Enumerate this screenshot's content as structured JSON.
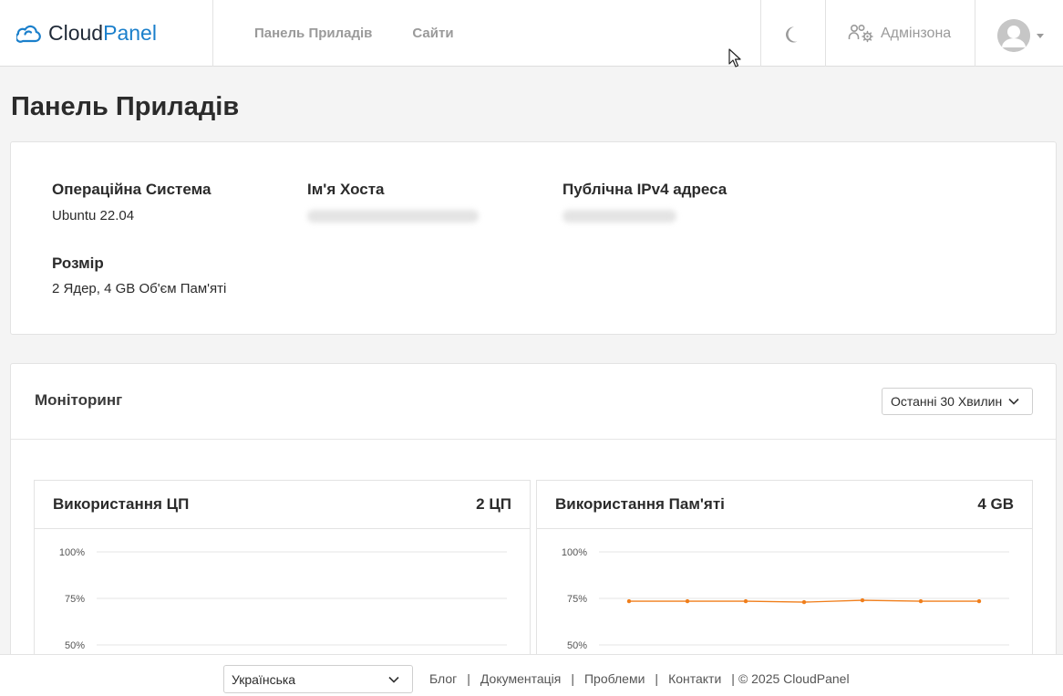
{
  "header": {
    "logo": {
      "part1": "Cloud",
      "part2": "Panel"
    },
    "nav": [
      "Панель Приладів",
      "Сайти"
    ],
    "admin_label": "Адмінзона"
  },
  "page": {
    "title": "Панель Приладів"
  },
  "info": {
    "os_label": "Операційна Система",
    "os_value": "Ubuntu 22.04",
    "host_label": "Ім'я Хоста",
    "ip_label": "Публічна IPv4 адреса",
    "size_label": "Розмір",
    "size_value": "2 Ядер, 4 GB Об'єм Пам'яті"
  },
  "monitoring": {
    "title": "Моніторинг",
    "range_selected": "Останні 30 Хвилин"
  },
  "charts": {
    "cpu": {
      "title": "Використання ЦП",
      "meta": "2 ЦП"
    },
    "memory": {
      "title": "Використання Пам'яті",
      "meta": "4 GB"
    }
  },
  "chart_data": [
    {
      "type": "line",
      "title": "Використання ЦП",
      "y_ticks": [
        "100%",
        "75%",
        "50%"
      ],
      "series": []
    },
    {
      "type": "line",
      "title": "Використання Пам'яті",
      "y_ticks": [
        "100%",
        "75%",
        "50%"
      ],
      "series": [
        {
          "color": "#f07e1b",
          "values": [
            73.5,
            73.5,
            73.5,
            73,
            74,
            73.5,
            73.5
          ]
        }
      ]
    }
  ],
  "footer": {
    "language": "Українська",
    "links": [
      "Блог",
      "Документація",
      "Проблеми",
      "Контакти"
    ],
    "copyright": "© 2025  CloudPanel"
  },
  "colors": {
    "brand": "#1a7fcb",
    "memory_line": "#f07e1b"
  }
}
